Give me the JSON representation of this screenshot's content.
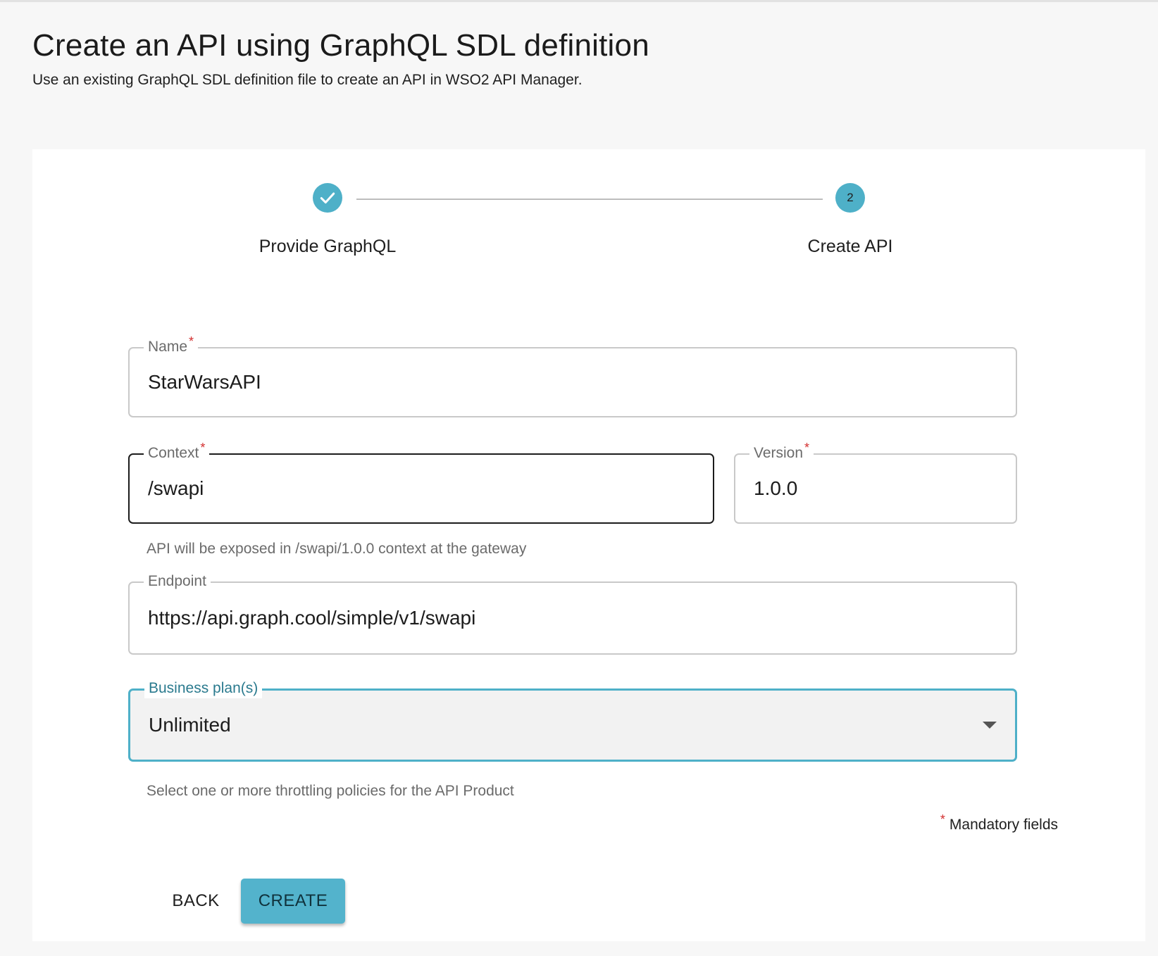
{
  "header": {
    "title": "Create an API using GraphQL SDL definition",
    "subtitle": "Use an existing GraphQL SDL definition file to create an API in WSO2 API Manager."
  },
  "stepper": {
    "steps": [
      {
        "label": "Provide GraphQL",
        "status": "completed",
        "icon": "check-icon"
      },
      {
        "label": "Create API",
        "status": "active",
        "number": "2"
      }
    ]
  },
  "form": {
    "name": {
      "label": "Name",
      "required_mark": "*",
      "value": "StarWarsAPI"
    },
    "context": {
      "label": "Context",
      "required_mark": "*",
      "value": "/swapi"
    },
    "version": {
      "label": "Version",
      "required_mark": "*",
      "value": "1.0.0"
    },
    "context_helper": "API will be exposed in /swapi/1.0.0 context at the gateway",
    "endpoint": {
      "label": "Endpoint",
      "value": "https://api.graph.cool/simple/v1/swapi"
    },
    "business_plans": {
      "label": "Business plan(s)",
      "value": "Unlimited",
      "icon": "chevron-down-icon"
    },
    "business_plans_helper": "Select one or more throttling policies for the API Product",
    "mandatory_mark": "*",
    "mandatory_text": "Mandatory fields"
  },
  "actions": {
    "back_label": "BACK",
    "create_label": "CREATE"
  },
  "colors": {
    "accent": "#4eb0c8",
    "required": "#d32f2f",
    "background": "#f7f7f7"
  }
}
